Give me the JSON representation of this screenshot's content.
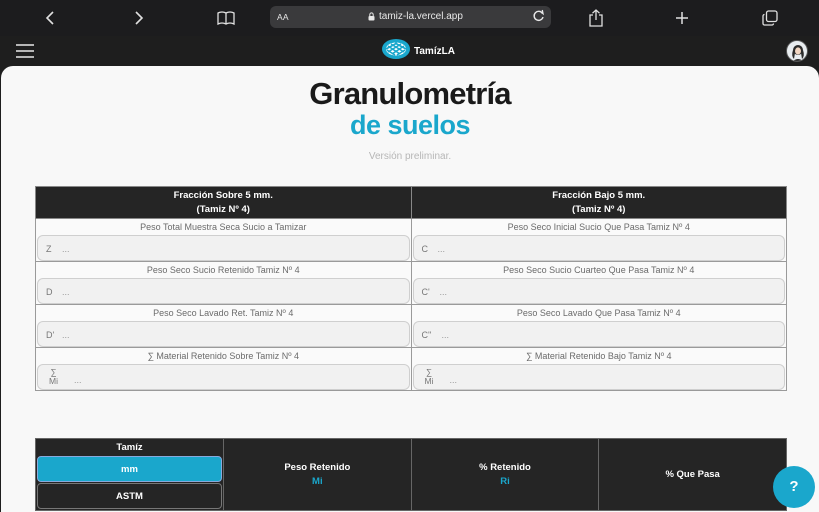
{
  "browser": {
    "url_text_size": "AA",
    "url": "tamiz-la.vercel.app"
  },
  "app_bar": {
    "brand_name": "TamízLA"
  },
  "page": {
    "title_line1": "Granulometría",
    "title_line2": "de suelos",
    "subtitle": "Versión preliminar."
  },
  "fraction_table": {
    "left_header_line1": "Fracción Sobre 5 mm.",
    "left_header_line2": "(Tamiz Nº 4)",
    "right_header_line1": "Fracción Bajo 5 mm.",
    "right_header_line2": "(Tamiz Nº 4)",
    "left_rows": [
      {
        "label": "Peso Total Muestra Seca Sucio a Tamizar",
        "prefix": "Z",
        "placeholder": "..."
      },
      {
        "label": "Peso Seco Sucio Retenido Tamiz Nº 4",
        "prefix": "D",
        "placeholder": "..."
      },
      {
        "label": "Peso Seco Lavado Ret. Tamiz Nº 4",
        "prefix": "D'",
        "placeholder": "..."
      },
      {
        "label": "∑ Material Retenido Sobre Tamiz Nº 4",
        "prefix_top": "∑",
        "prefix_bottom": "Mi",
        "placeholder": "..."
      }
    ],
    "right_rows": [
      {
        "label": "Peso Seco Inicial Sucio Que Pasa Tamiz Nº 4",
        "prefix": "C",
        "placeholder": "..."
      },
      {
        "label": "Peso Seco Sucio Cuarteo Que Pasa Tamiz Nº 4",
        "prefix": "C'",
        "placeholder": "..."
      },
      {
        "label": "Peso Seco Lavado Que Pasa Tamiz Nº 4",
        "prefix": "C''",
        "placeholder": "..."
      },
      {
        "label": "∑ Material Retenido Bajo Tamiz Nº 4",
        "prefix_top": "∑",
        "prefix_bottom": "Mi",
        "placeholder": "..."
      }
    ]
  },
  "sieve_table": {
    "tamiz_header": "Tamíz",
    "unit_selected": "mm",
    "unit_other": "ASTM",
    "col2": "Peso Retenido",
    "col2_sub": "Mi",
    "col3": "% Retenido",
    "col3_sub": "Ri",
    "col4": "% Que Pasa"
  },
  "help_button": "?",
  "colors": {
    "accent": "#1aa7cc",
    "header_bg": "#252525",
    "page_bg": "#f8f8f8"
  }
}
